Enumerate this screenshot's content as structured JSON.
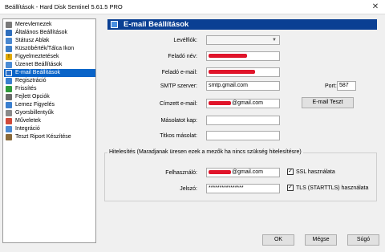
{
  "window": {
    "title": "Beállítások - Hard Disk Sentinel 5.61.5 PRO",
    "close_glyph": "✕"
  },
  "sidebar": {
    "items": [
      {
        "label": "Merevlemezek",
        "icon": "disk-icon",
        "color": "#7a7a7a"
      },
      {
        "label": "Általános Beállítások",
        "icon": "settings-icon",
        "color": "#2f6fbd"
      },
      {
        "label": "Státusz Ablak",
        "icon": "window-icon",
        "color": "#4a88d0"
      },
      {
        "label": "Küszöbérték/Tálca Ikon",
        "icon": "threshold-icon",
        "color": "#3d7ec8"
      },
      {
        "label": "Figyelmeztetések",
        "icon": "warning-icon",
        "color": "#e0a800"
      },
      {
        "label": "Üzenet Beállítások",
        "icon": "message-icon",
        "color": "#4b8bd4"
      },
      {
        "label": "E-mail Beállítások",
        "icon": "email-icon",
        "color": "#2a6fc9"
      },
      {
        "label": "Regisztráció",
        "icon": "registration-icon",
        "color": "#3a7fcf"
      },
      {
        "label": "Frissítés",
        "icon": "update-icon",
        "color": "#2e9a3a"
      },
      {
        "label": "Fejlett Opciók",
        "icon": "advanced-options-icon",
        "color": "#6a6a6a"
      },
      {
        "label": "Lemez Figyelés",
        "icon": "disk-monitor-icon",
        "color": "#3a7fcf"
      },
      {
        "label": "Gyorsbillentyűk",
        "icon": "keyboard-icon",
        "color": "#8a8a8a"
      },
      {
        "label": "Műveletek",
        "icon": "actions-icon",
        "color": "#d04a3a"
      },
      {
        "label": "Integráció",
        "icon": "integration-icon",
        "color": "#4b8bd4"
      },
      {
        "label": "Teszt Riport Készítése",
        "icon": "report-icon",
        "color": "#8a6a3a"
      }
    ],
    "selected_index": 6,
    "selected_color": "#0a64c8"
  },
  "heading": {
    "title": "E-mail Beállítások",
    "color": "#0a3f93"
  },
  "form": {
    "profile_label": "Levélfiók:",
    "sender_name_label": "Feladó név:",
    "sender_email_label": "Feladó e-mail:",
    "smtp_label": "SMTP szerver:",
    "smtp_value": "smtp.gmail.com",
    "port_label": "Port:",
    "port_value": "587",
    "recipient_label": "Címzett e-mail:",
    "recipient_value_suffix": "@gmail.com",
    "cc_label": "Másolatot kap:",
    "bcc_label": "Titkos másolat:",
    "test_button": "E-mail Teszt"
  },
  "auth": {
    "legend": "Hitelesítés (Maradjanak üresen ezek a mezők ha nincs szükség hitelesítésre)",
    "username_label": "Felhasználó:",
    "username_suffix": "@gmail.com",
    "password_label": "Jelszó:",
    "password_value": "****************",
    "ssl_label": "SSL használata",
    "ssl_checked": true,
    "tls_label": "TLS (STARTTLS) használata",
    "tls_checked": true,
    "check_glyph": "✓"
  },
  "buttons": {
    "ok": "OK",
    "cancel": "Mégse",
    "help": "Súgó"
  },
  "redaction_color": "#e0142a"
}
